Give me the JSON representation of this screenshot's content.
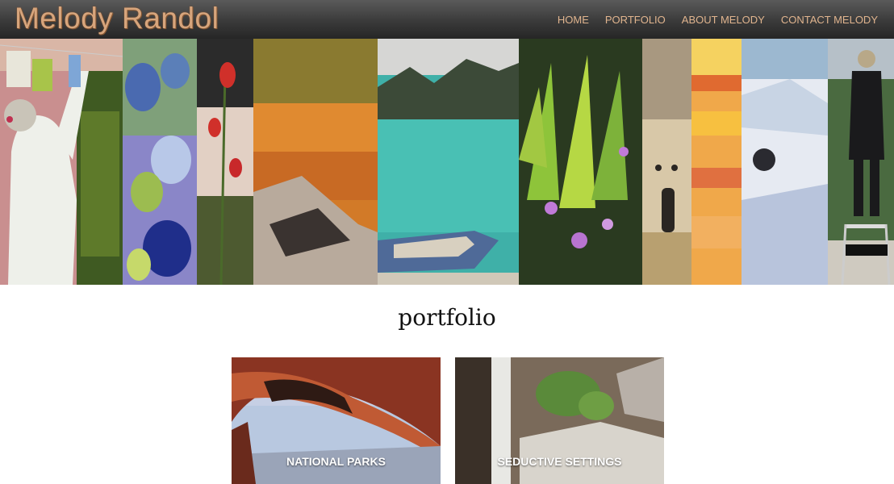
{
  "site": {
    "logo": "Melody Randol"
  },
  "nav": {
    "items": [
      {
        "label": "HOME"
      },
      {
        "label": "PORTFOLIO"
      },
      {
        "label": "ABOUT MELODY"
      },
      {
        "label": "CONTACT MELODY"
      }
    ]
  },
  "page": {
    "title": "portfolio"
  },
  "portfolio": {
    "cards": [
      {
        "label": "NATIONAL PARKS"
      },
      {
        "label": "SEDUCTIVE SETTINGS"
      }
    ]
  },
  "colors": {
    "logo": "#d7a57c",
    "nav_text": "#e0b48e",
    "header_bg": "#3a3a3a"
  }
}
